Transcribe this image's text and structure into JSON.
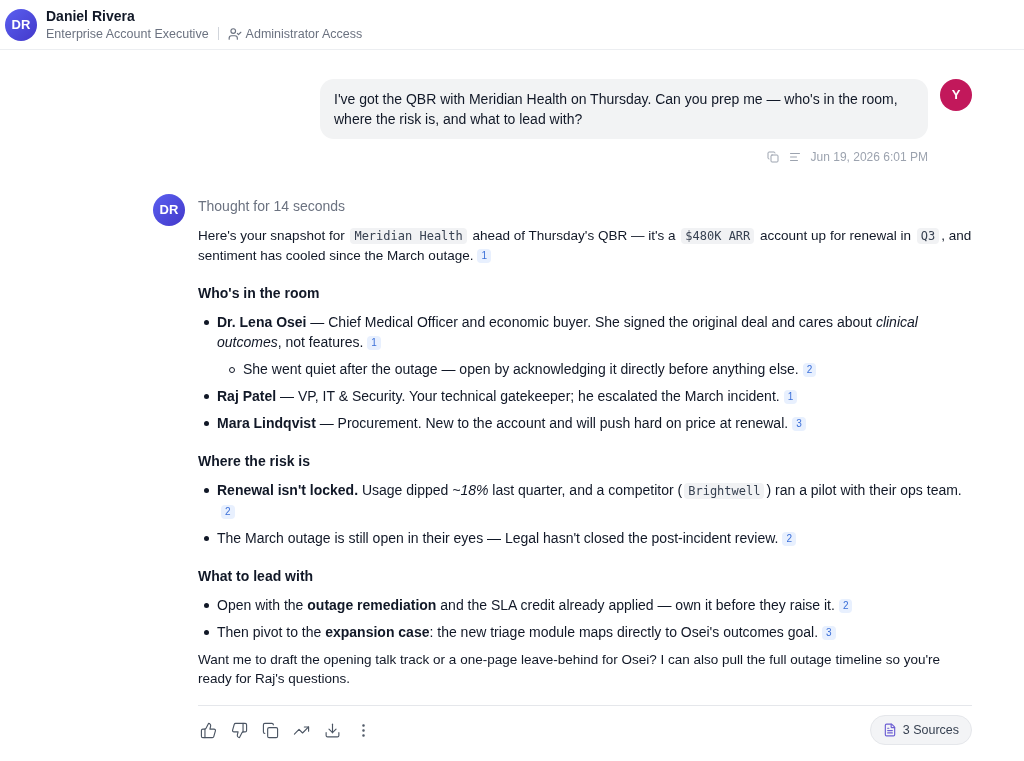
{
  "header": {
    "initials": "DR",
    "name": "Daniel Rivera",
    "role": "Enterprise Account Executive",
    "access": "Administrator Access"
  },
  "user_message": {
    "initials": "Y",
    "text": "I've got the QBR with Meridian Health on Thursday. Can you prep me — who's in the room, where the risk is, and what to lead with?",
    "timestamp": "Jun 19, 2026 6:01 PM"
  },
  "assistant": {
    "initials": "DR",
    "thought": "Thought for 14 seconds",
    "blocks": [
      {
        "kind": "paragraph",
        "segments": [
          {
            "kind": "text",
            "text": "Here's your snapshot for "
          },
          {
            "kind": "code",
            "text": "Meridian Health"
          },
          {
            "kind": "text",
            "text": " ahead of Thursday's QBR — it's a "
          },
          {
            "kind": "code",
            "text": "$480K ARR"
          },
          {
            "kind": "text",
            "text": " account up for renewal in "
          },
          {
            "kind": "code",
            "text": "Q3"
          },
          {
            "kind": "text",
            "text": ", and sentiment has cooled since the March outage."
          },
          {
            "kind": "cite",
            "text": "1"
          }
        ]
      },
      {
        "kind": "heading",
        "text": "Who's in the room"
      },
      {
        "kind": "list",
        "items": [
          {
            "segments": [
              {
                "kind": "text",
                "text": "**Dr. Lena Osei** — Chief Medical Officer and economic buyer. She signed the original deal and cares about *clinical outcomes*, not features."
              },
              {
                "kind": "cite",
                "text": "1"
              }
            ],
            "children": [
              {
                "segments": [
                  {
                    "kind": "text",
                    "text": "She went quiet after the outage — open by acknowledging it directly before anything else."
                  },
                  {
                    "kind": "cite",
                    "text": "2"
                  }
                ]
              }
            ]
          },
          {
            "segments": [
              {
                "kind": "text",
                "text": "**Raj Patel** — VP, IT & Security. Your technical gatekeeper; he escalated the March incident."
              },
              {
                "kind": "cite",
                "text": "1"
              }
            ]
          },
          {
            "segments": [
              {
                "kind": "text",
                "text": "**Mara Lindqvist** — Procurement. New to the account and will push hard on price at renewal."
              },
              {
                "kind": "cite",
                "text": "3"
              }
            ]
          }
        ]
      },
      {
        "kind": "heading",
        "text": "Where the risk is"
      },
      {
        "kind": "list",
        "items": [
          {
            "segments": [
              {
                "kind": "text",
                "text": "**Renewal isn't locked.** Usage dipped *~18%* last quarter, and a competitor ("
              },
              {
                "kind": "code",
                "text": "Brightwell"
              },
              {
                "kind": "text",
                "text": ") ran a pilot with their ops team."
              },
              {
                "kind": "cite",
                "text": "2"
              }
            ]
          },
          {
            "segments": [
              {
                "kind": "text",
                "text": "The March outage is still open in their eyes — Legal hasn't closed the post-incident review."
              },
              {
                "kind": "cite",
                "text": "2"
              }
            ]
          }
        ]
      },
      {
        "kind": "heading",
        "text": "What to lead with"
      },
      {
        "kind": "list",
        "items": [
          {
            "segments": [
              {
                "kind": "text",
                "text": "Open with the **outage remediation** and the SLA credit already applied — own it before they raise it."
              },
              {
                "kind": "cite",
                "text": "2"
              }
            ]
          },
          {
            "segments": [
              {
                "kind": "text",
                "text": "Then pivot to the **expansion case**: the new triage module maps directly to Osei's outcomes goal."
              },
              {
                "kind": "cite",
                "text": "3"
              }
            ]
          }
        ]
      },
      {
        "kind": "paragraph",
        "segments": [
          {
            "kind": "text",
            "text": "Want me to draft the opening talk track or a one-page leave-behind for Osei? I can also pull the full outage timeline so you're ready for Raj's questions."
          }
        ]
      }
    ],
    "sources": "3 Sources"
  }
}
